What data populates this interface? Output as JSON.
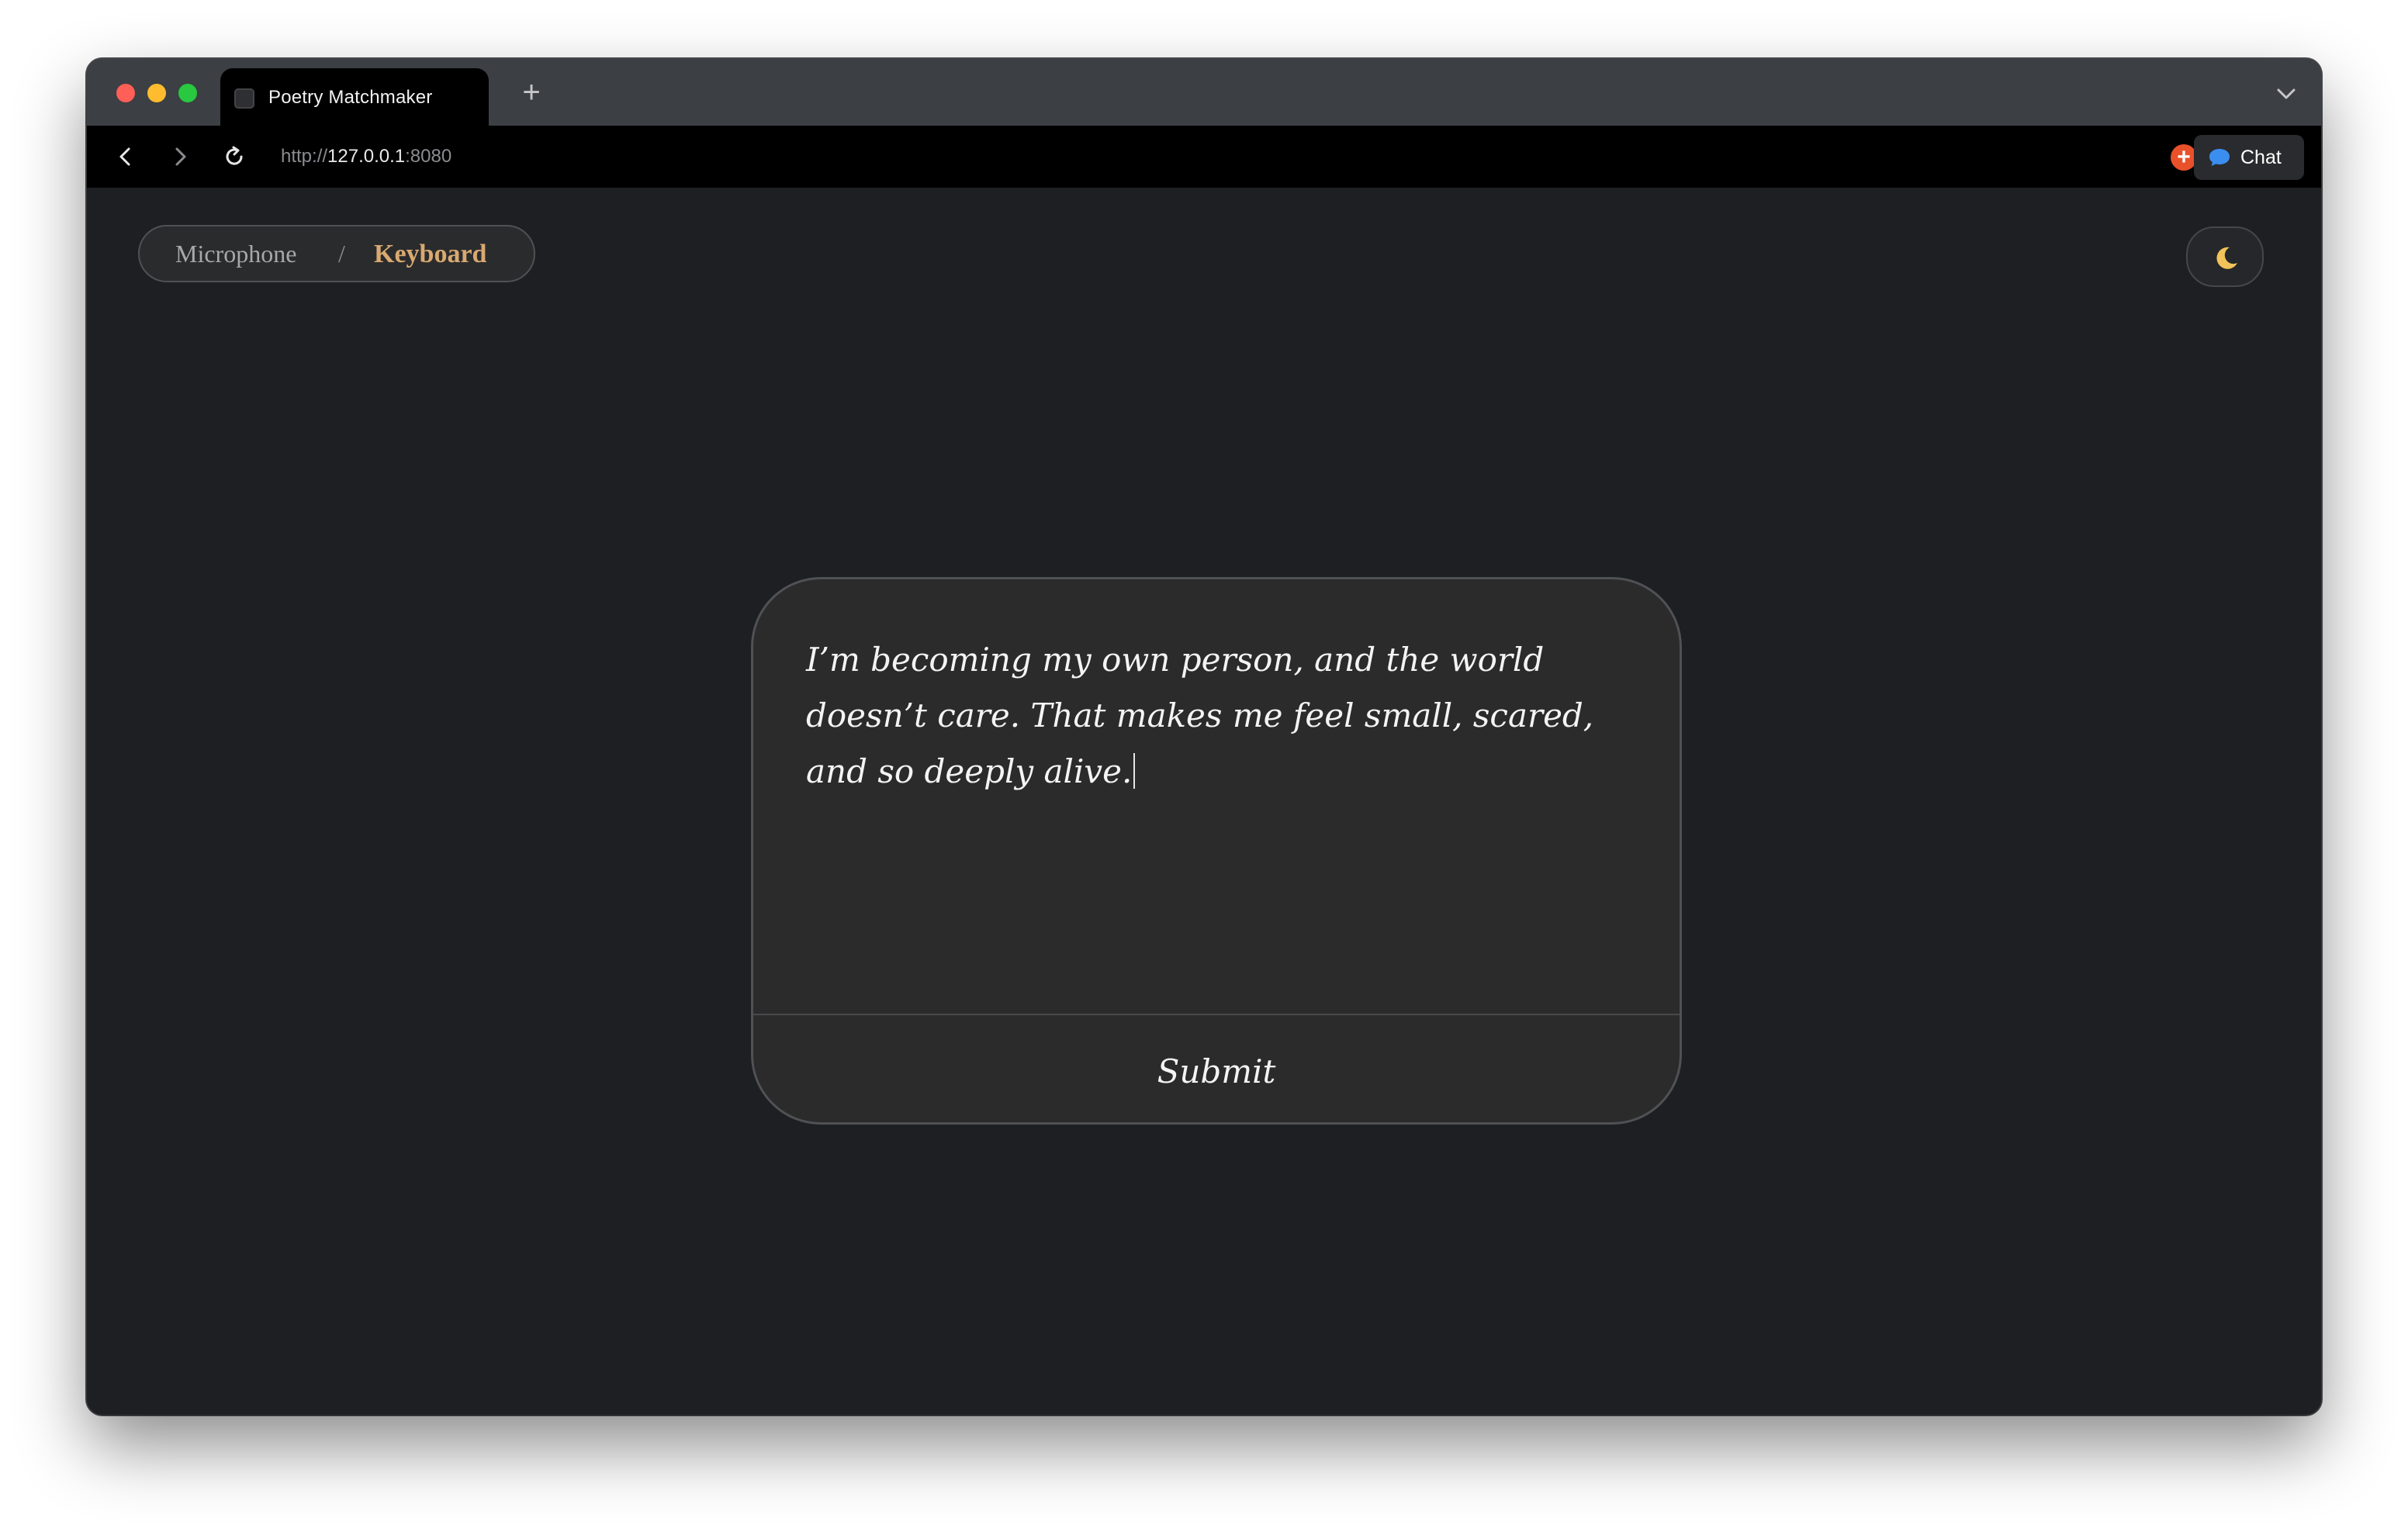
{
  "browser": {
    "tab": {
      "title": "Poetry Matchmaker"
    },
    "new_tab_symbol": "+",
    "address": {
      "scheme": "http://",
      "host": "127.0.0.1",
      "port": ":8080"
    },
    "chat_button_label": "Chat",
    "extension_symbol": "+",
    "colors": {
      "chrome": "#3c3f43",
      "toolbar": "#000000",
      "close": "#fe5f57",
      "minimize": "#febc2e",
      "maximize": "#28c840",
      "chat_icon": "#3a8ef0",
      "extension": "#e8512a"
    }
  },
  "page": {
    "mode_toggle": {
      "microphone_label": "Microphone",
      "separator": "/",
      "keyboard_label": "Keyboard",
      "active": "Keyboard"
    },
    "theme_toggle_icon": "moon-icon",
    "entry": {
      "text": "I’m becoming my own person, and the world doesn’t care. That makes me feel small, scared, and so deeply alive.",
      "submit_label": "Submit"
    },
    "colors": {
      "background": "#1e1f22",
      "card": "#2b2b2c",
      "accent": "#d9a970",
      "text": "#f4f4f4"
    }
  }
}
